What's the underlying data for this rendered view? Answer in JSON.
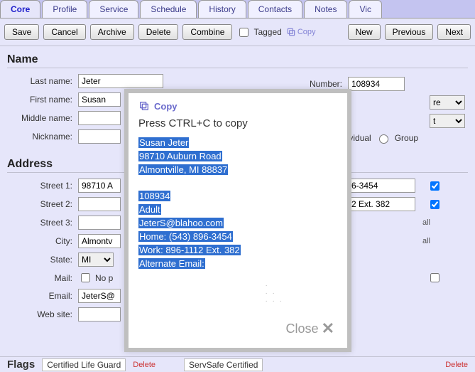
{
  "tabs": [
    "Core",
    "Profile",
    "Service",
    "Schedule",
    "History",
    "Contacts",
    "Notes",
    "Vic"
  ],
  "active_tab": 0,
  "toolbar": {
    "save": "Save",
    "cancel": "Cancel",
    "archive": "Archive",
    "delete": "Delete",
    "combine": "Combine",
    "tagged": "Tagged",
    "copy": "Copy",
    "new": "New",
    "previous": "Previous",
    "next": "Next"
  },
  "name_section": {
    "heading": "Name",
    "last_label": "Last name:",
    "last": "Jeter",
    "first_label": "First name:",
    "first": "Susan",
    "middle_label": "Middle name:",
    "middle": "",
    "nick_label": "Nickname:",
    "nick": "",
    "number_label": "Number:",
    "number": "108934",
    "dropdown1": "re",
    "dropdown2": "t",
    "type_individual": "Individual",
    "type_group": "Group"
  },
  "address_section": {
    "heading": "Address",
    "s1_label": "Street 1:",
    "s1": "98710 A",
    "s2_label": "Street 2:",
    "s2": "",
    "s3_label": "Street 3:",
    "s3": "",
    "city_label": "City:",
    "city": "Almontv",
    "state_label": "State:",
    "state": "MI",
    "mail_label": "Mail:",
    "mail_nop": "No p",
    "email_label": "Email:",
    "email": "JeterS@",
    "web_label": "Web site:",
    "web": "",
    "phone1": "6-3454",
    "phone2": "2 Ext. 382",
    "call": "all"
  },
  "flags": {
    "title": "Flags",
    "items": [
      "Certified Life Guard",
      "ServSafe Certified"
    ],
    "delete": "Delete"
  },
  "modal": {
    "title": "Copy",
    "instruction": "Press CTRL+C to copy",
    "lines": [
      "Susan Jeter",
      "98710 Auburn Road",
      "Almontville, MI  88837",
      "",
      "108934",
      "Adult",
      "JeterS@blahoo.com",
      "Home: (543) 896-3454",
      "Work: 896-1112 Ext. 382",
      "Alternate Email:"
    ],
    "close": "Close"
  }
}
